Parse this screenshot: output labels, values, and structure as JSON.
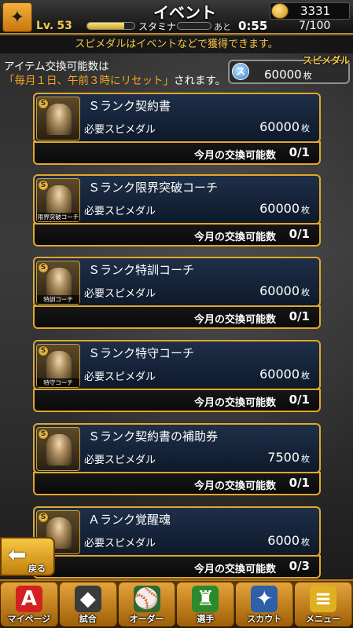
{
  "header": {
    "title": "イベント",
    "level_prefix": "Lv.",
    "level": "53",
    "stamina_label": "スタミナ",
    "time_prefix": "あと",
    "timer": "0:55",
    "stamina_count": "7/100",
    "coins": "3331"
  },
  "notice": "スピメダルはイベントなどで獲得できます。",
  "info": {
    "line1": "アイテム交換可能数は",
    "line2_highlight": "「毎月１日、午前３時にリセット」",
    "line2_rest": "されます。"
  },
  "medal": {
    "label": "スピメダル",
    "icon_letter": "ス",
    "value": "60000",
    "unit": "枚"
  },
  "card_common": {
    "req_label": "必要スピメダル",
    "limit_label": "今月の交換可能数",
    "unit": "枚"
  },
  "cards": [
    {
      "name": "Ｓランク契約書",
      "cost": "60000",
      "limit": "0/1",
      "thumb_caption": "",
      "thumb_icon": "contract-icon"
    },
    {
      "name": "Ｓランク限界突破コーチ",
      "cost": "60000",
      "limit": "0/1",
      "thumb_caption": "限界突破コーチ",
      "thumb_icon": "coach-icon"
    },
    {
      "name": "Ｓランク特訓コーチ",
      "cost": "60000",
      "limit": "0/1",
      "thumb_caption": "特訓コーチ",
      "thumb_icon": "coach-icon"
    },
    {
      "name": "Ｓランク特守コーチ",
      "cost": "60000",
      "limit": "0/1",
      "thumb_caption": "特守コーチ",
      "thumb_icon": "coach-icon"
    },
    {
      "name": "Ｓランク契約書の補助券",
      "cost": "7500",
      "limit": "0/1",
      "thumb_caption": "",
      "thumb_icon": "ticket-icon"
    },
    {
      "name": "Ａランク覚醒魂",
      "cost": "6000",
      "limit": "0/3",
      "thumb_caption": "",
      "thumb_icon": "soul-icon"
    }
  ],
  "back_label": "戻る",
  "nav": [
    {
      "label": "マイページ",
      "icon": "mypage-icon",
      "glyph": "A"
    },
    {
      "label": "試合",
      "icon": "match-icon",
      "glyph": "◆"
    },
    {
      "label": "オーダー",
      "icon": "order-icon",
      "glyph": "⚾"
    },
    {
      "label": "選手",
      "icon": "player-icon",
      "glyph": "♜"
    },
    {
      "label": "スカウト",
      "icon": "scout-icon",
      "glyph": "✦"
    },
    {
      "label": "メニュー",
      "icon": "menu-icon",
      "glyph": "≡"
    }
  ]
}
